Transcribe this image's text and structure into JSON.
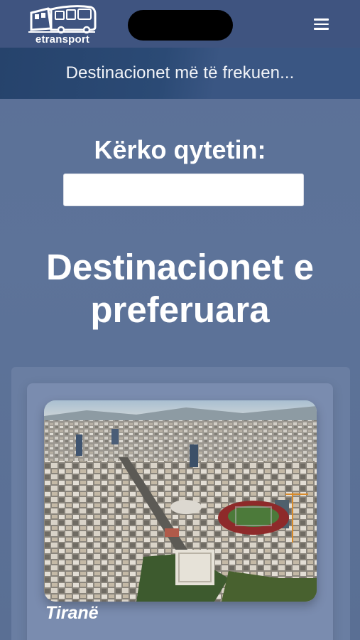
{
  "header": {
    "logo_text": "etransport",
    "logo_icon": "bus-icon",
    "menu_icon": "hamburger-menu-icon"
  },
  "banner": {
    "text": "Destinacionet më të frekuen..."
  },
  "search": {
    "label": "Kërko qytetin:",
    "value": "",
    "placeholder": ""
  },
  "favorites": {
    "title": "Destinacionet e preferuara",
    "cards": [
      {
        "city": "Tiranë",
        "image_icon": "city-aerial-photo"
      }
    ]
  },
  "colors": {
    "topbar": "#3f5480",
    "banner": "#2b4a75",
    "background": "#5b7097",
    "card": "#7a8caf"
  }
}
